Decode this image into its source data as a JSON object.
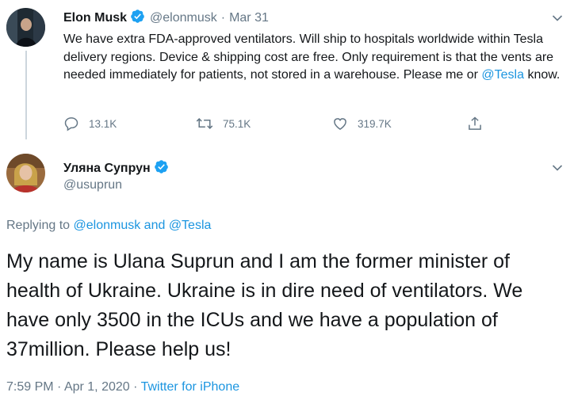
{
  "parent_tweet": {
    "author_name": "Elon Musk",
    "handle": "@elonmusk",
    "separator": "·",
    "date": "Mar 31",
    "text_before": "We have extra FDA-approved ventilators. Will ship to hospitals worldwide within Tesla delivery regions. Device & shipping cost are free. Only requirement is that the vents are needed immediately for patients, not stored in a warehouse. Please me or ",
    "mention": "@Tesla",
    "text_after": " know.",
    "actions": {
      "reply_count": "13.1K",
      "retweet_count": "75.1K",
      "like_count": "319.7K"
    }
  },
  "main_tweet": {
    "author_name": "Уляна Супрун",
    "handle": "@usuprun",
    "replying_prefix": "Replying to ",
    "replying_user1": "@elonmusk",
    "replying_and": " and ",
    "replying_user2": "@Tesla",
    "text": "My name is Ulana Suprun and I am the former minister of health of Ukraine. Ukraine is in dire need of ventilators. We have only 3500 in the ICUs and we have a population of  37million. Please help us!",
    "time": "7:59 PM",
    "separator1": "·",
    "date": "Apr 1, 2020",
    "separator2": "·",
    "source": "Twitter for iPhone"
  },
  "colors": {
    "accent": "#1da1f2",
    "link": "#1b95e0",
    "muted": "#657786",
    "text": "#14171a"
  }
}
